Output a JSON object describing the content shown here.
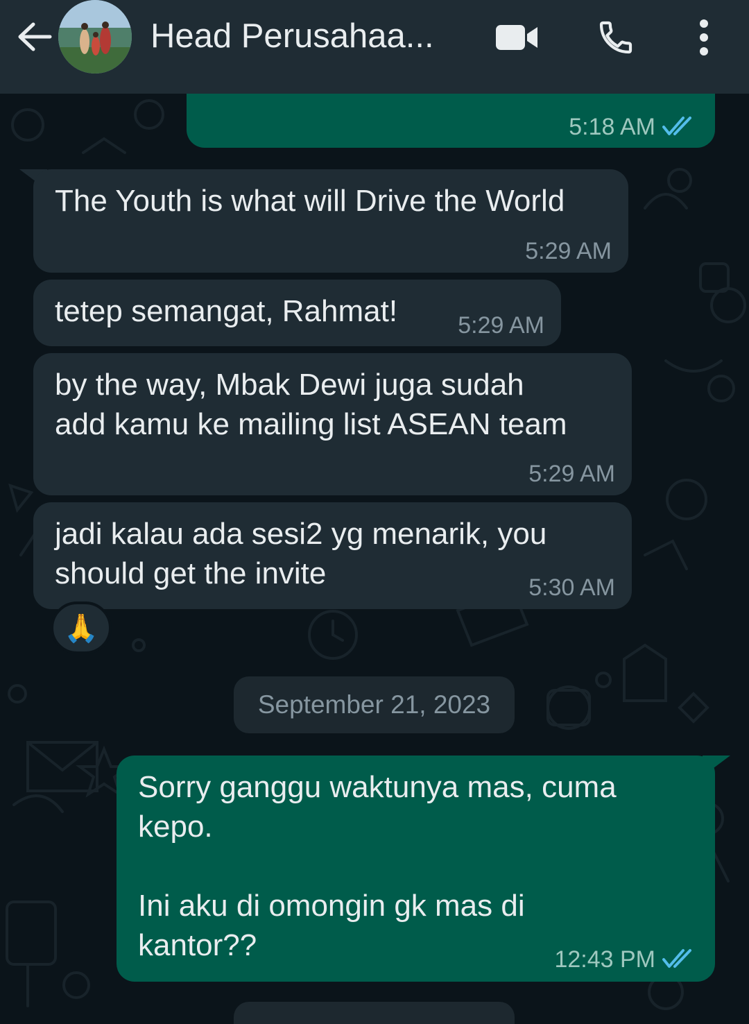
{
  "header": {
    "contact_name": "Head Perusahaa...",
    "back_icon": "arrow-left-icon",
    "avatar_icon": "contact-avatar",
    "video_call_icon": "video-camera-icon",
    "voice_call_icon": "phone-icon",
    "menu_icon": "more-vertical-icon"
  },
  "messages": [
    {
      "direction": "out",
      "text": "",
      "time": "5:18 AM",
      "status": "read"
    },
    {
      "direction": "in",
      "text": "The Youth is what will Drive the World",
      "time": "5:29 AM"
    },
    {
      "direction": "in",
      "text": "tetep semangat, Rahmat!",
      "time": "5:29 AM"
    },
    {
      "direction": "in",
      "text": "by the way, Mbak Dewi juga sudah\nadd kamu ke mailing list ASEAN team",
      "time": "5:29 AM"
    },
    {
      "direction": "in",
      "text": "jadi kalau ada sesi2 yg menarik, you\nshould get the invite",
      "time": "5:30 AM",
      "reaction": "🙏"
    },
    {
      "direction": "out",
      "text": "Sorry ganggu waktunya mas, cuma\nkepo.\n\nIni aku di omongin gk mas di\nkantor??",
      "time": "12:43 PM",
      "status": "read"
    }
  ],
  "date_separator": "September 21, 2023",
  "colors": {
    "background": "#0b141a",
    "header": "#1f2c34",
    "incoming_bubble": "#1f2c34",
    "outgoing_bubble": "#005c4b",
    "read_ticks": "#53bdeb"
  }
}
